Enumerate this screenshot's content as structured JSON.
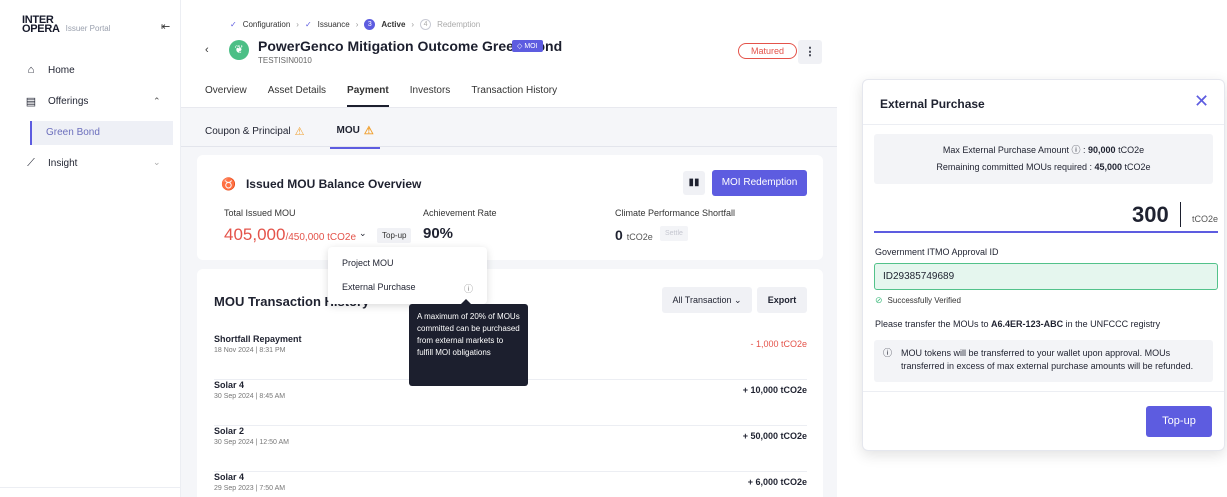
{
  "sidebar": {
    "logo_line1": "INTER",
    "logo_line2": "OPERA",
    "logo_sub": "Issuer Portal",
    "items": [
      {
        "label": "Home",
        "icon": "home-icon"
      },
      {
        "label": "Offerings",
        "icon": "store-icon"
      },
      {
        "label": "Green Bond"
      },
      {
        "label": "Insight",
        "icon": "chart-line-icon"
      }
    ]
  },
  "steps": {
    "s1": "Configuration",
    "s2": "Issuance",
    "s3_num": "3",
    "s3": "Active",
    "s4_num": "4",
    "s4": "Redemption"
  },
  "bond": {
    "title": "PowerGenco Mitigation Outcome Green Bond",
    "badge": "MOI",
    "code": "TESTISIN0010",
    "status": "Matured"
  },
  "tabs": [
    "Overview",
    "Asset Details",
    "Payment",
    "Investors",
    "Transaction History"
  ],
  "subtabs": [
    "Coupon & Principal",
    "MOU"
  ],
  "balance": {
    "title": "Issued MOU Balance Overview",
    "redeem_label": "MOI Redemption",
    "total_label": "Total Issued MOU",
    "total_value": "405,000",
    "total_of": "/450,000 tCO2e",
    "topup_label": "Top-up",
    "rate_label": "Achievement Rate",
    "rate_value": "90%",
    "short_label": "Climate Performance Shortfall",
    "short_value": "0",
    "short_unit": "tCO2e",
    "settle_label": "Settle"
  },
  "transactions": {
    "title": "MOU Transaction History",
    "filter_label": "All Transaction",
    "export_label": "Export",
    "rows": [
      {
        "name": "Shortfall Repayment",
        "date": "18 Nov 2024 | 8:31 PM",
        "amount": "- 1,000 tCO2e"
      },
      {
        "name": "Solar 4",
        "date": "30 Sep 2024 | 8:45 AM",
        "amount": "+ 10,000 tCO2e"
      },
      {
        "name": "Solar 2",
        "date": "30 Sep 2024 | 12:50 AM",
        "amount": "+ 50,000 tCO2e"
      },
      {
        "name": "Solar 4",
        "date": "29 Sep 2023 | 7:50 AM",
        "amount": "+ 6,000 tCO2e"
      }
    ]
  },
  "dropdown": {
    "items": [
      "Project MOU",
      "External Purchase"
    ],
    "tooltip": "A maximum of 20% of MOUs committed can be purchased from external markets to fulfill MOI obligations"
  },
  "modal": {
    "title": "External Purchase",
    "max_label": "Max External Purchase Amount",
    "max_value": "90,000",
    "max_unit": "tCO2e",
    "remaining_label": "Remaining committed MOUs required :",
    "remaining_value": "45,000",
    "remaining_unit": "tCO2e",
    "amount": "300",
    "amount_unit": "tCO2e",
    "field_label": "Government ITMO Approval ID",
    "field_value": "ID29385749689",
    "verified": "Successfully Verified",
    "transfer_prefix": "Please transfer the MOUs to ",
    "transfer_account": "A6.4ER-123-ABC",
    "transfer_suffix": " in the UNFCCC registry",
    "notice": "MOU tokens will be transferred to your wallet upon approval. MOUs transferred in excess of max external purchase amounts will be refunded.",
    "topup_label": "Top-up"
  },
  "colors": {
    "accent": "#5d5ce0",
    "danger": "#e4534a",
    "success": "#4cbf86",
    "warning": "#f0a030"
  }
}
